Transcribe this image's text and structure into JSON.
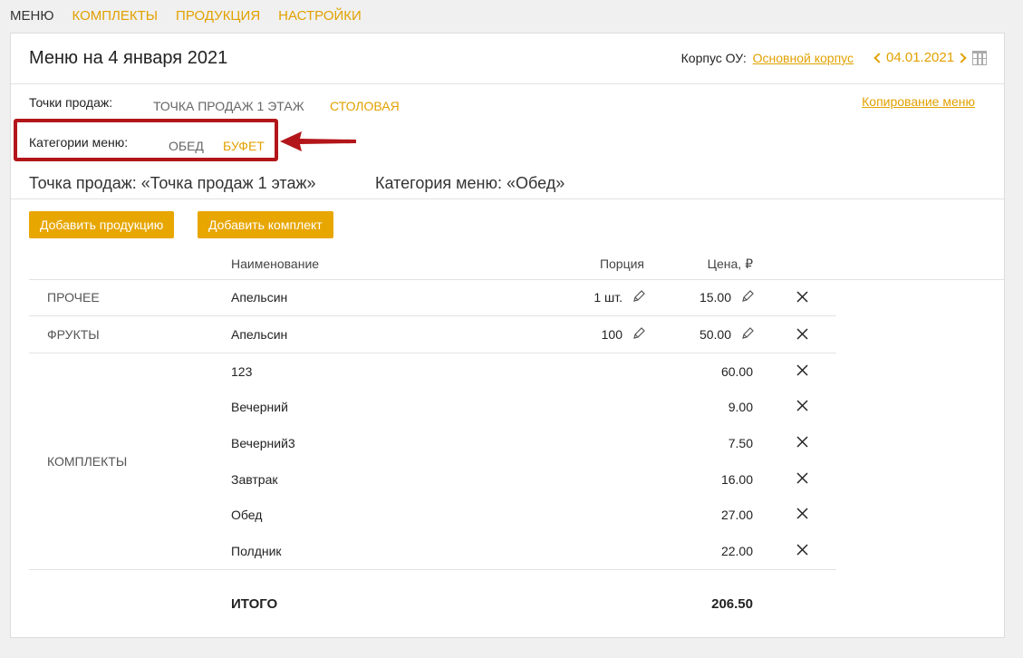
{
  "topnav": {
    "items": [
      {
        "label": "МЕНЮ",
        "active": true
      },
      {
        "label": "КОМПЛЕКТЫ",
        "active": false
      },
      {
        "label": "ПРОДУКЦИЯ",
        "active": false
      },
      {
        "label": "НАСТРОЙКИ",
        "active": false
      }
    ]
  },
  "header": {
    "title": "Меню на 4 января 2021",
    "korpus_label": "Корпус ОУ:",
    "korpus_value": "Основной корпус",
    "date": "04.01.2021"
  },
  "points": {
    "label": "Точки продаж:",
    "tabs": [
      "ТОЧКА ПРОДАЖ 1 ЭТАЖ",
      "СТОЛОВАЯ"
    ],
    "copy_link": "Копирование меню"
  },
  "categories": {
    "label": "Категории меню:",
    "tabs": [
      "ОБЕД",
      "БУФЕТ"
    ]
  },
  "subheading": {
    "point": "Точка продаж: «Точка продаж 1 этаж»",
    "category": "Категория меню: «Обед»"
  },
  "buttons": {
    "add_product": "Добавить продукцию",
    "add_set": "Добавить комплект"
  },
  "table": {
    "headers": {
      "name": "Наименование",
      "portion": "Порция",
      "price": "Цена, ₽"
    },
    "groups": [
      {
        "category": "ПРОЧЕЕ",
        "rows": [
          {
            "name": "Апельсин",
            "portion": "1 шт.",
            "price": "15.00"
          }
        ]
      },
      {
        "category": "ФРУКТЫ",
        "rows": [
          {
            "name": "Апельсин",
            "portion": "100",
            "price": "50.00"
          }
        ]
      },
      {
        "category": "КОМПЛЕКТЫ",
        "rows": [
          {
            "name": "123",
            "price": "60.00"
          },
          {
            "name": "Вечерний",
            "price": "9.00"
          },
          {
            "name": "Вечерний3",
            "price": "7.50"
          },
          {
            "name": "Завтрак",
            "price": "16.00"
          },
          {
            "name": "Обед",
            "price": "27.00"
          },
          {
            "name": "Полдник",
            "price": "22.00"
          }
        ]
      }
    ],
    "total_label": "ИТОГО",
    "total_value": "206.50"
  },
  "colors": {
    "accent": "#e2a100",
    "button": "#e8a600",
    "highlight": "#b3161a"
  }
}
